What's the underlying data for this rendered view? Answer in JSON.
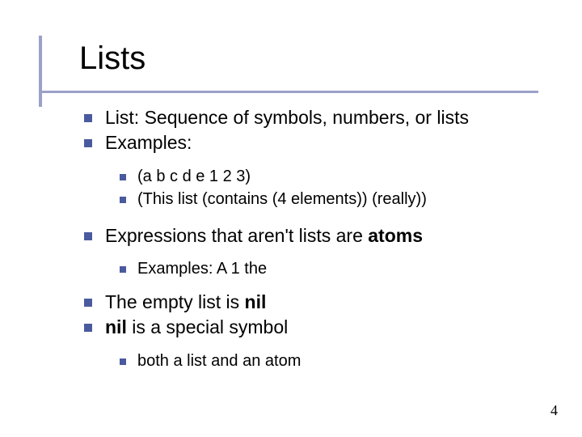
{
  "title": "Lists",
  "bullets": {
    "b1": "List: Sequence of symbols, numbers, or lists",
    "b2": "Examples:",
    "b2a": "(a b c d e 1 2 3)",
    "b2b": "(This list (contains (4 elements)) (really))",
    "b3_pre": "Expressions that aren't lists are ",
    "b3_bold": "atoms",
    "b3a": "Examples:  A  1  the",
    "b4_pre": "The empty list is ",
    "b4_bold": "nil",
    "b5_bold": "nil",
    "b5_post": " is a special symbol",
    "b5a": "both a list and an atom"
  },
  "page_number": "4"
}
